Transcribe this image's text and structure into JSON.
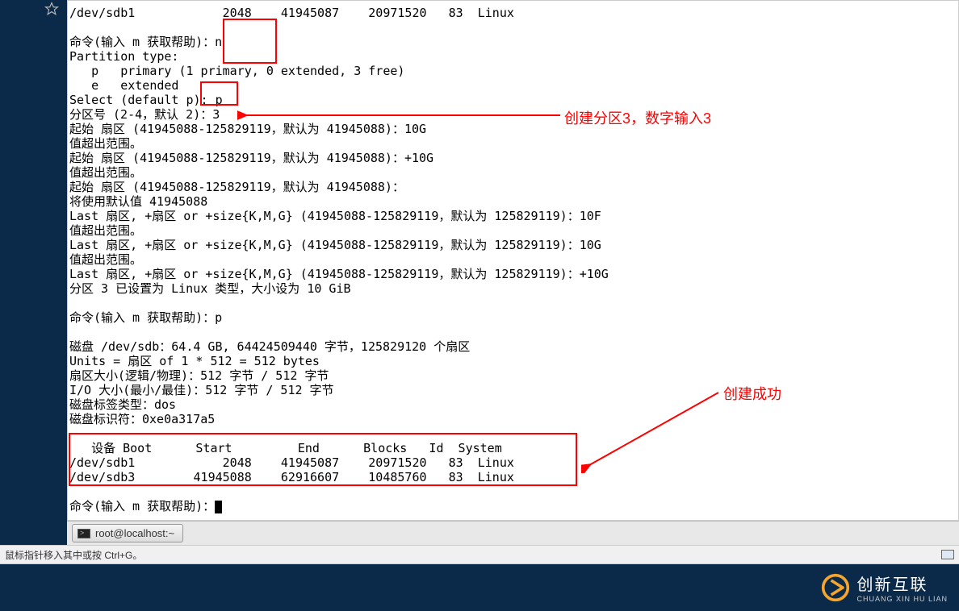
{
  "star_icon_name": "favorite-star-icon",
  "terminal": {
    "lines": [
      "/dev/sdb1            2048    41945087    20971520   83  Linux",
      "",
      "命令(输入 m 获取帮助)：n",
      "Partition type:",
      "   p   primary (1 primary, 0 extended, 3 free)",
      "   e   extended",
      "Select (default p): p",
      "分区号 (2-4，默认 2)：3",
      "起始 扇区 (41945088-125829119，默认为 41945088)：10G",
      "值超出范围。",
      "起始 扇区 (41945088-125829119，默认为 41945088)：+10G",
      "值超出范围。",
      "起始 扇区 (41945088-125829119，默认为 41945088)：",
      "将使用默认值 41945088",
      "Last 扇区, +扇区 or +size{K,M,G} (41945088-125829119，默认为 125829119)：10F",
      "值超出范围。",
      "Last 扇区, +扇区 or +size{K,M,G} (41945088-125829119，默认为 125829119)：10G",
      "值超出范围。",
      "Last 扇区, +扇区 or +size{K,M,G} (41945088-125829119，默认为 125829119)：+10G",
      "分区 3 已设置为 Linux 类型，大小设为 10 GiB",
      "",
      "命令(输入 m 获取帮助)：p",
      "",
      "磁盘 /dev/sdb：64.4 GB, 64424509440 字节，125829120 个扇区",
      "Units = 扇区 of 1 * 512 = 512 bytes",
      "扇区大小(逻辑/物理)：512 字节 / 512 字节",
      "I/O 大小(最小/最佳)：512 字节 / 512 字节",
      "磁盘标签类型：dos",
      "磁盘标识符：0xe0a317a5",
      "",
      "   设备 Boot      Start         End      Blocks   Id  System",
      "/dev/sdb1            2048    41945087    20971520   83  Linux",
      "/dev/sdb3        41945088    62916607    10485760   83  Linux",
      "",
      "命令(输入 m 获取帮助)："
    ]
  },
  "annotations": {
    "create_partition3": "创建分区3，数字输入3",
    "create_success": "创建成功"
  },
  "taskbar": {
    "item1": "root@localhost:~"
  },
  "status": {
    "hint": "鼠标指针移入其中或按 Ctrl+G。"
  },
  "logo": {
    "cn": "创新互联",
    "en": "CHUANG XIN HU LIAN"
  }
}
